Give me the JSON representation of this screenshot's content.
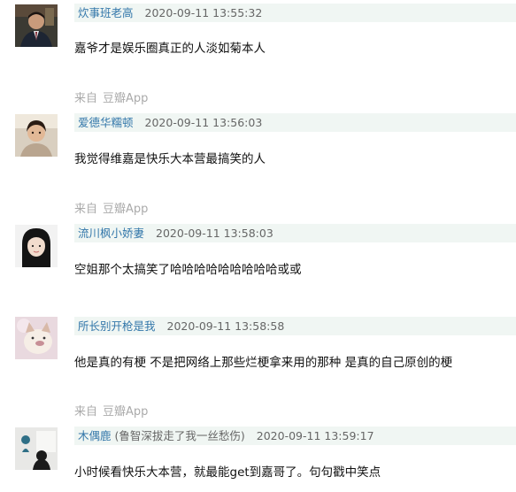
{
  "comments": [
    {
      "author": "炊事班老高",
      "date": "2020-09-11 13:55:32",
      "text": "嘉爷才是娱乐圈真正的人淡如菊本人",
      "source_prefix": "来自",
      "source_app": "豆瓣App"
    },
    {
      "author": "爱德华糯顿",
      "date": "2020-09-11 13:56:03",
      "text": "我觉得维嘉是快乐大本营最搞笑的人",
      "source_prefix": "来自",
      "source_app": "豆瓣App"
    },
    {
      "author": "流川枫小娇妻",
      "date": "2020-09-11 13:58:03",
      "text": "空姐那个太搞笑了哈哈哈哈哈哈哈哈哈或或"
    },
    {
      "author": "所长别开枪是我",
      "date": "2020-09-11 13:58:58",
      "text": "他是真的有梗 不是把网络上那些烂梗拿来用的那种 是真的自己原创的梗",
      "source_prefix": "来自",
      "source_app": "豆瓣App"
    },
    {
      "author": "木偶鹿",
      "author_note": "(鲁智深拔走了我一丝愁伤)",
      "date": "2020-09-11 13:59:17",
      "text": "小时候看快乐大本营，就最能get到嘉哥了。句句戳中笑点"
    }
  ],
  "colors": {
    "author_link": "#3377aa",
    "meta_bar_bg": "#f0f6f3",
    "source_text": "#aaaaaa"
  }
}
